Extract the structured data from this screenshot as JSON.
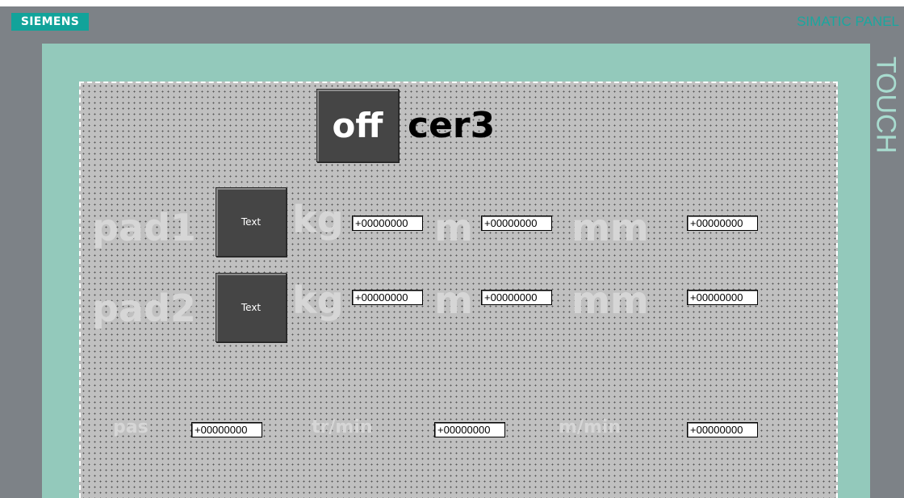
{
  "device": {
    "brand": "SIEMENS",
    "model_label": "SIMATIC PANEL",
    "touch_label": "TOUCH"
  },
  "screen": {
    "header": {
      "off_button_label": "off",
      "title": "cer3"
    },
    "pads": [
      {
        "label": "pad1",
        "button_label": "Text",
        "kg_unit": "kg",
        "kg_value": "+00000000",
        "m_unit": "m",
        "m_value": "+00000000",
        "mm_unit": "mm",
        "mm_value": "+00000000"
      },
      {
        "label": "pad2",
        "button_label": "Text",
        "kg_unit": "kg",
        "kg_value": "+00000000",
        "m_unit": "m",
        "m_value": "+00000000",
        "mm_unit": "mm",
        "mm_value": "+00000000"
      }
    ],
    "bottom": {
      "pas_label": "pas",
      "pas_value": "+00000000",
      "trmin_label": "tr/min",
      "trmin_value": "+00000000",
      "mmin_label": "m/min",
      "mmin_value": "+00000000"
    }
  },
  "colors": {
    "bezel": "#7d8287",
    "frame": "#93c9bb",
    "screen": "#c0c0c0",
    "brand": "#12a39a",
    "button": "#454545",
    "faded_label": "#d6d6d6"
  }
}
